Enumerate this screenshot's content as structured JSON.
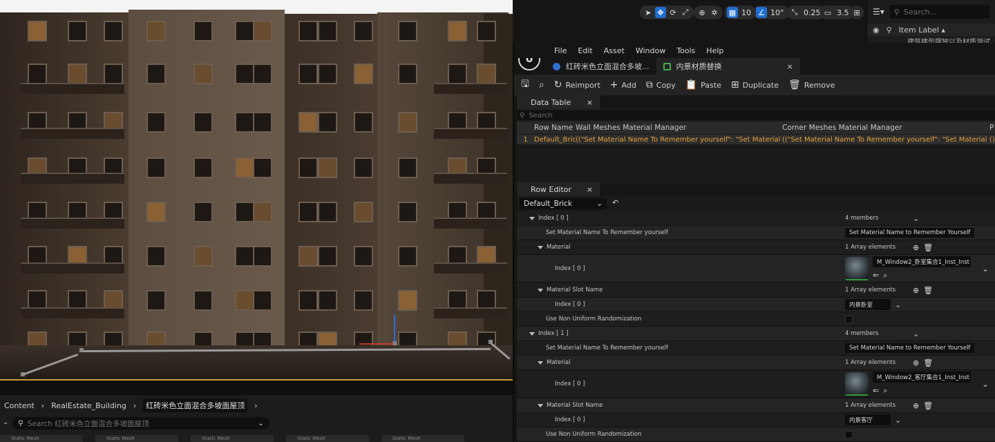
{
  "viewport": {
    "toolbar": {
      "grid_value": "10",
      "angle_value": "10°",
      "scale_value": "0.25",
      "camera_speed": "3.5"
    }
  },
  "outliner": {
    "search_placeholder": "Search...",
    "column_label": "Item Label",
    "row_text": "建筑楼型摆放以及材质测试"
  },
  "editor": {
    "menu": [
      "File",
      "Edit",
      "Asset",
      "Window",
      "Tools",
      "Help"
    ],
    "tabs": [
      {
        "label": "红砖米色立面混合多坡..."
      },
      {
        "label": "内景材质替换"
      }
    ],
    "toolbar": {
      "reimport": "Reimport",
      "add": "Add",
      "copy": "Copy",
      "paste": "Paste",
      "duplicate": "Duplicate",
      "remove": "Remove"
    },
    "data_table": {
      "tab_label": "Data Table",
      "search_placeholder": "Search",
      "columns": [
        "Row Name",
        "Wall Meshes Material Manager",
        "Corner Meshes Material Manager",
        "P"
      ],
      "rows": [
        {
          "index": "1",
          "name": "Default_Bric",
          "wall": "((\"Set Material Name To Remember yourself\": \"Set Material Name to Remember",
          "corner": "((\"Set Material Name To Remember yourself\": \"Set Material Name to Remember",
          "p": "()"
        }
      ]
    },
    "row_editor": {
      "tab_label": "Row Editor",
      "selected_row": "Default_Brick",
      "properties": {
        "index0": "Index [ 0 ]",
        "index0_members": "4 members",
        "set_name_label": "Set Material Name To Remember yourself",
        "set_name_value": "Set Material Name to Remember Yourself",
        "material_label": "Material",
        "array_count": "1 Array elements",
        "sub_index0": "Index [ 0 ]",
        "asset1": "M_Window2_卧室集合1_Inst_Inst",
        "slot_label": "Material Slot Name",
        "slot1": "内景卧室",
        "non_uniform_label": "Use Non Uniform Randomization",
        "index1": "Index [ 1 ]",
        "index1_members": "4 members",
        "asset2": "M_Window2_客厅集合1_Inst_Inst",
        "slot2": "内景客厅",
        "corner_label": "Corner Meshes Material Manager"
      }
    }
  },
  "content_browser": {
    "breadcrumbs": [
      "Content",
      "RealEstate_Building",
      "红砖米色立面混合多坡面屋顶"
    ],
    "search_placeholder": "Search 红砖米色立面混合多坡面屋顶",
    "tile_label": "Static Mesh"
  }
}
